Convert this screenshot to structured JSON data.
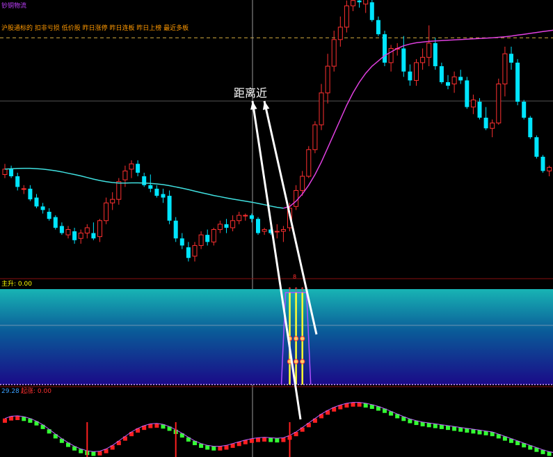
{
  "top_title": "钞铜物流",
  "top_tags": "沪股通标的 扣非亏损 低价股 昨日涨停 昨日连板 昨日上榜 最近多板",
  "annotation": "距离近",
  "panel2_label": "主升: 0.00",
  "panel2_marker": "8",
  "panel3_value": "29.28",
  "panel3_label": "起涨: 0.00",
  "colors": {
    "background": "#000000",
    "up": "#ff3030",
    "down": "#00e5ff",
    "ma_long": "#e040e0",
    "ma_short": "#40e0e0",
    "dashed_level": "#d8b040",
    "tag_text": "#ff9900",
    "title_text": "#c040ff",
    "yellow_label": "#ffff00",
    "blue_label": "#3aa0ff",
    "red_label": "#ff3030",
    "green_bar": "#33ff33",
    "red_bar": "#ff2020"
  },
  "chart_data": [
    {
      "type": "candlestick",
      "candles": [
        {
          "o": 5.2,
          "h": 5.8,
          "l": 5.0,
          "c": 5.5
        },
        {
          "o": 5.5,
          "h": 5.7,
          "l": 5.0,
          "c": 5.1
        },
        {
          "o": 5.1,
          "h": 5.3,
          "l": 4.3,
          "c": 4.5
        },
        {
          "o": 4.4,
          "h": 4.6,
          "l": 4.1,
          "c": 4.4
        },
        {
          "o": 4.4,
          "h": 4.6,
          "l": 3.7,
          "c": 3.8
        },
        {
          "o": 3.9,
          "h": 4.1,
          "l": 3.3,
          "c": 3.4
        },
        {
          "o": 3.4,
          "h": 3.6,
          "l": 3.0,
          "c": 3.2
        },
        {
          "o": 3.1,
          "h": 3.3,
          "l": 2.6,
          "c": 2.7
        },
        {
          "o": 2.8,
          "h": 2.9,
          "l": 2.1,
          "c": 2.2
        },
        {
          "o": 2.3,
          "h": 2.5,
          "l": 1.8,
          "c": 1.9
        },
        {
          "o": 1.8,
          "h": 2.3,
          "l": 1.6,
          "c": 2.1
        },
        {
          "o": 2.0,
          "h": 2.2,
          "l": 1.3,
          "c": 1.5
        },
        {
          "o": 1.6,
          "h": 2.1,
          "l": 1.3,
          "c": 1.9
        },
        {
          "o": 1.9,
          "h": 2.4,
          "l": 1.6,
          "c": 2.2
        },
        {
          "o": 1.9,
          "h": 2.5,
          "l": 1.5,
          "c": 1.6
        },
        {
          "o": 1.7,
          "h": 2.7,
          "l": 1.4,
          "c": 2.6
        },
        {
          "o": 2.6,
          "h": 3.9,
          "l": 2.4,
          "c": 3.6
        },
        {
          "o": 3.6,
          "h": 4.2,
          "l": 3.2,
          "c": 3.8
        },
        {
          "o": 3.8,
          "h": 5.0,
          "l": 3.5,
          "c": 4.8
        },
        {
          "o": 4.9,
          "h": 5.7,
          "l": 4.5,
          "c": 5.4
        },
        {
          "o": 5.5,
          "h": 6.0,
          "l": 5.0,
          "c": 5.8
        },
        {
          "o": 5.8,
          "h": 6.0,
          "l": 5.1,
          "c": 5.3
        },
        {
          "o": 5.1,
          "h": 5.3,
          "l": 4.5,
          "c": 4.6
        },
        {
          "o": 4.6,
          "h": 5.2,
          "l": 4.2,
          "c": 4.4
        },
        {
          "o": 4.4,
          "h": 4.6,
          "l": 3.9,
          "c": 4.0
        },
        {
          "o": 4.1,
          "h": 4.4,
          "l": 3.6,
          "c": 3.9
        },
        {
          "o": 4.0,
          "h": 4.3,
          "l": 2.4,
          "c": 2.6
        },
        {
          "o": 2.6,
          "h": 2.8,
          "l": 1.4,
          "c": 1.6
        },
        {
          "o": 1.6,
          "h": 1.9,
          "l": 1.0,
          "c": 1.2
        },
        {
          "o": 1.1,
          "h": 1.4,
          "l": 0.3,
          "c": 0.5
        },
        {
          "o": 0.6,
          "h": 1.4,
          "l": 0.3,
          "c": 1.2
        },
        {
          "o": 1.2,
          "h": 2.0,
          "l": 1.0,
          "c": 1.8
        },
        {
          "o": 1.8,
          "h": 2.1,
          "l": 1.2,
          "c": 1.4
        },
        {
          "o": 1.4,
          "h": 2.2,
          "l": 1.2,
          "c": 2.1
        },
        {
          "o": 2.1,
          "h": 2.6,
          "l": 1.9,
          "c": 2.4
        },
        {
          "o": 2.4,
          "h": 2.7,
          "l": 1.9,
          "c": 2.2
        },
        {
          "o": 2.2,
          "h": 2.9,
          "l": 2.0,
          "c": 2.6
        },
        {
          "o": 2.6,
          "h": 3.1,
          "l": 2.4,
          "c": 2.9
        },
        {
          "o": 2.9,
          "h": 3.0,
          "l": 2.6,
          "c": 2.9
        },
        {
          "o": 2.9,
          "h": 3.0,
          "l": 2.5,
          "c": 2.7
        },
        {
          "o": 2.7,
          "h": 2.8,
          "l": 1.8,
          "c": 1.9
        },
        {
          "o": 2.0,
          "h": 2.2,
          "l": 1.8,
          "c": 2.1
        },
        {
          "o": 2.1,
          "h": 2.3,
          "l": 1.8,
          "c": 1.9
        },
        {
          "o": 2.0,
          "h": 2.4,
          "l": 1.6,
          "c": 2.0
        },
        {
          "o": 2.0,
          "h": 2.3,
          "l": 1.4,
          "c": 2.1
        },
        {
          "o": 2.2,
          "h": 3.6,
          "l": 2.0,
          "c": 3.3
        },
        {
          "o": 3.4,
          "h": 4.6,
          "l": 3.2,
          "c": 4.3
        },
        {
          "o": 4.3,
          "h": 5.4,
          "l": 4.0,
          "c": 5.1
        },
        {
          "o": 5.1,
          "h": 6.8,
          "l": 5.0,
          "c": 6.6
        },
        {
          "o": 6.6,
          "h": 8.2,
          "l": 6.4,
          "c": 8.0
        },
        {
          "o": 8.0,
          "h": 10.3,
          "l": 7.7,
          "c": 9.8
        },
        {
          "o": 9.8,
          "h": 12.0,
          "l": 9.2,
          "c": 11.3
        },
        {
          "o": 11.3,
          "h": 13.3,
          "l": 11.0,
          "c": 12.8
        },
        {
          "o": 12.8,
          "h": 14.1,
          "l": 12.4,
          "c": 13.5
        },
        {
          "o": 13.5,
          "h": 15.0,
          "l": 13.2,
          "c": 14.7
        },
        {
          "o": 14.7,
          "h": 15.2,
          "l": 14.4,
          "c": 15.0
        },
        {
          "o": 15.0,
          "h": 15.2,
          "l": 14.6,
          "c": 14.9
        },
        {
          "o": 14.8,
          "h": 15.2,
          "l": 14.3,
          "c": 15.1
        },
        {
          "o": 14.9,
          "h": 15.1,
          "l": 13.8,
          "c": 13.9
        },
        {
          "o": 13.9,
          "h": 14.1,
          "l": 13.0,
          "c": 13.1
        },
        {
          "o": 13.1,
          "h": 13.3,
          "l": 11.3,
          "c": 11.5
        },
        {
          "o": 11.5,
          "h": 12.5,
          "l": 11.0,
          "c": 12.3
        },
        {
          "o": 12.3,
          "h": 12.6,
          "l": 11.9,
          "c": 12.3
        },
        {
          "o": 12.3,
          "h": 13.0,
          "l": 10.7,
          "c": 11.0
        },
        {
          "o": 11.0,
          "h": 11.4,
          "l": 10.2,
          "c": 10.5
        },
        {
          "o": 10.5,
          "h": 11.7,
          "l": 10.2,
          "c": 11.5
        },
        {
          "o": 11.5,
          "h": 12.3,
          "l": 11.1,
          "c": 11.8
        },
        {
          "o": 11.8,
          "h": 13.6,
          "l": 11.3,
          "c": 12.6
        },
        {
          "o": 12.6,
          "h": 12.9,
          "l": 11.1,
          "c": 11.3
        },
        {
          "o": 11.3,
          "h": 11.5,
          "l": 10.3,
          "c": 10.4
        },
        {
          "o": 10.4,
          "h": 10.8,
          "l": 10.0,
          "c": 10.2
        },
        {
          "o": 10.3,
          "h": 11.0,
          "l": 9.8,
          "c": 10.7
        },
        {
          "o": 10.7,
          "h": 11.1,
          "l": 10.3,
          "c": 10.5
        },
        {
          "o": 10.5,
          "h": 10.7,
          "l": 8.9,
          "c": 9.0
        },
        {
          "o": 9.0,
          "h": 9.7,
          "l": 8.6,
          "c": 9.4
        },
        {
          "o": 9.3,
          "h": 9.5,
          "l": 8.3,
          "c": 8.4
        },
        {
          "o": 8.4,
          "h": 9.0,
          "l": 7.7,
          "c": 7.8
        },
        {
          "o": 7.8,
          "h": 8.3,
          "l": 7.3,
          "c": 8.1
        },
        {
          "o": 8.1,
          "h": 10.6,
          "l": 8.0,
          "c": 10.3
        },
        {
          "o": 10.3,
          "h": 12.4,
          "l": 9.6,
          "c": 12.0
        },
        {
          "o": 12.0,
          "h": 12.4,
          "l": 11.1,
          "c": 11.5
        },
        {
          "o": 11.5,
          "h": 11.7,
          "l": 9.1,
          "c": 9.3
        },
        {
          "o": 9.3,
          "h": 9.4,
          "l": 8.3,
          "c": 8.4
        },
        {
          "o": 8.4,
          "h": 8.5,
          "l": 7.2,
          "c": 7.3
        },
        {
          "o": 7.3,
          "h": 7.4,
          "l": 6.1,
          "c": 6.2
        },
        {
          "o": 6.2,
          "h": 6.3,
          "l": 5.3,
          "c": 5.4
        },
        {
          "o": 5.4,
          "h": 5.7,
          "l": 5.1,
          "c": 5.6
        },
        {
          "o": 5.6,
          "h": 5.7,
          "l": 4.9,
          "c": 5.0
        },
        {
          "o": 5.0,
          "h": 5.1,
          "l": 4.4,
          "c": 4.5
        }
      ],
      "ma_long": [
        5.5,
        5.52,
        5.54,
        5.55,
        5.55,
        5.53,
        5.5,
        5.46,
        5.41,
        5.35,
        5.27,
        5.2,
        5.12,
        5.03,
        4.94,
        4.86,
        4.8,
        4.75,
        4.72,
        4.72,
        4.73,
        4.73,
        4.72,
        4.7,
        4.67,
        4.63,
        4.57,
        4.5,
        4.43,
        4.35,
        4.26,
        4.18,
        4.1,
        4.02,
        3.95,
        3.88,
        3.82,
        3.76,
        3.7,
        3.64,
        3.57,
        3.5,
        3.42,
        3.35,
        3.3,
        3.4,
        3.7,
        4.1,
        4.6,
        5.2,
        5.9,
        6.7,
        7.5,
        8.3,
        9.1,
        9.8,
        10.4,
        10.9,
        11.3,
        11.6,
        11.9,
        12.1,
        12.3,
        12.45,
        12.55,
        12.62,
        12.66,
        12.7,
        12.72,
        12.74,
        12.76,
        12.78,
        12.8,
        12.82,
        12.84,
        12.86,
        12.88,
        12.9,
        12.93,
        12.96,
        13.0,
        13.05,
        13.1,
        13.15,
        13.2,
        13.25,
        13.3,
        13.35,
        13.4
      ],
      "dashed_level": 12.9,
      "ylim": [
        0,
        15.5
      ]
    },
    {
      "type": "indicator-area",
      "spike_range": [
        45,
        47
      ],
      "spike_values": [
        1,
        1,
        1
      ],
      "marker_levels": [
        0.5,
        0.25
      ],
      "baseline": 0,
      "midline": 0.55
    },
    {
      "type": "histogram",
      "values": [
        0.3,
        0.35,
        0.36,
        0.34,
        0.3,
        0.24,
        0.16,
        0.06,
        -0.05,
        -0.15,
        -0.24,
        -0.32,
        -0.38,
        -0.42,
        -0.44,
        -0.43,
        -0.38,
        -0.3,
        -0.2,
        -0.1,
        0.0,
        0.08,
        0.14,
        0.18,
        0.19,
        0.17,
        0.12,
        0.05,
        -0.03,
        -0.12,
        -0.2,
        -0.26,
        -0.3,
        -0.32,
        -0.32,
        -0.3,
        -0.26,
        -0.22,
        -0.18,
        -0.15,
        -0.13,
        -0.12,
        -0.13,
        -0.14,
        -0.13,
        -0.08,
        0.0,
        0.1,
        0.2,
        0.3,
        0.4,
        0.48,
        0.55,
        0.6,
        0.64,
        0.66,
        0.66,
        0.64,
        0.61,
        0.57,
        0.52,
        0.46,
        0.4,
        0.34,
        0.29,
        0.25,
        0.22,
        0.2,
        0.18,
        0.16,
        0.14,
        0.12,
        0.1,
        0.08,
        0.06,
        0.04,
        0.02,
        0.0,
        -0.05,
        -0.1,
        -0.15,
        -0.2,
        -0.25,
        -0.3,
        -0.35,
        -0.4,
        -0.44,
        -0.47,
        -0.5
      ],
      "spikes_at": [
        13,
        27,
        45
      ],
      "ylim": [
        -0.6,
        0.8
      ]
    }
  ]
}
